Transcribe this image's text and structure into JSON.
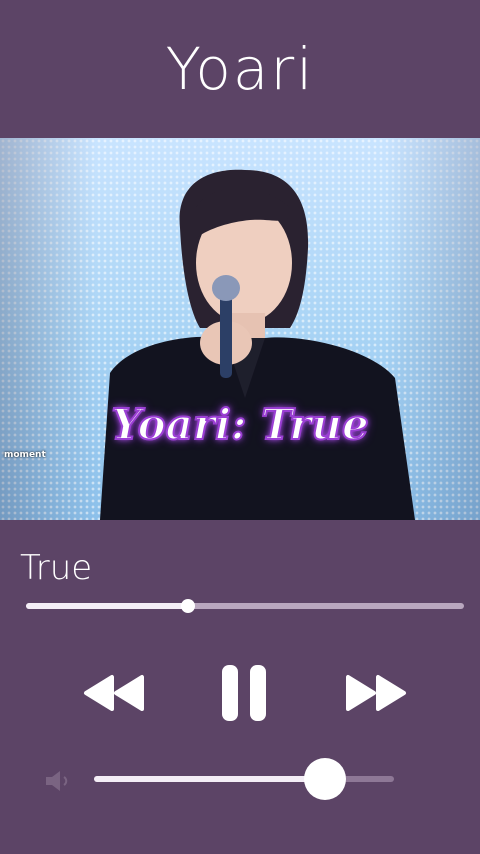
{
  "header": {
    "artist": "Yoari"
  },
  "video": {
    "caption": "Yoari: True",
    "corner_text": "moment"
  },
  "track": {
    "title": "True"
  },
  "progress": {
    "fraction": 0.37
  },
  "controls": {
    "rewind_icon": "rewind-icon",
    "pause_icon": "pause-icon",
    "forward_icon": "fast-forward-icon"
  },
  "volume": {
    "icon": "speaker-icon",
    "level": 0.77
  },
  "colors": {
    "background": "#5c4466",
    "accent": "#ffffff",
    "caption_glow": "#9b3fd4"
  }
}
